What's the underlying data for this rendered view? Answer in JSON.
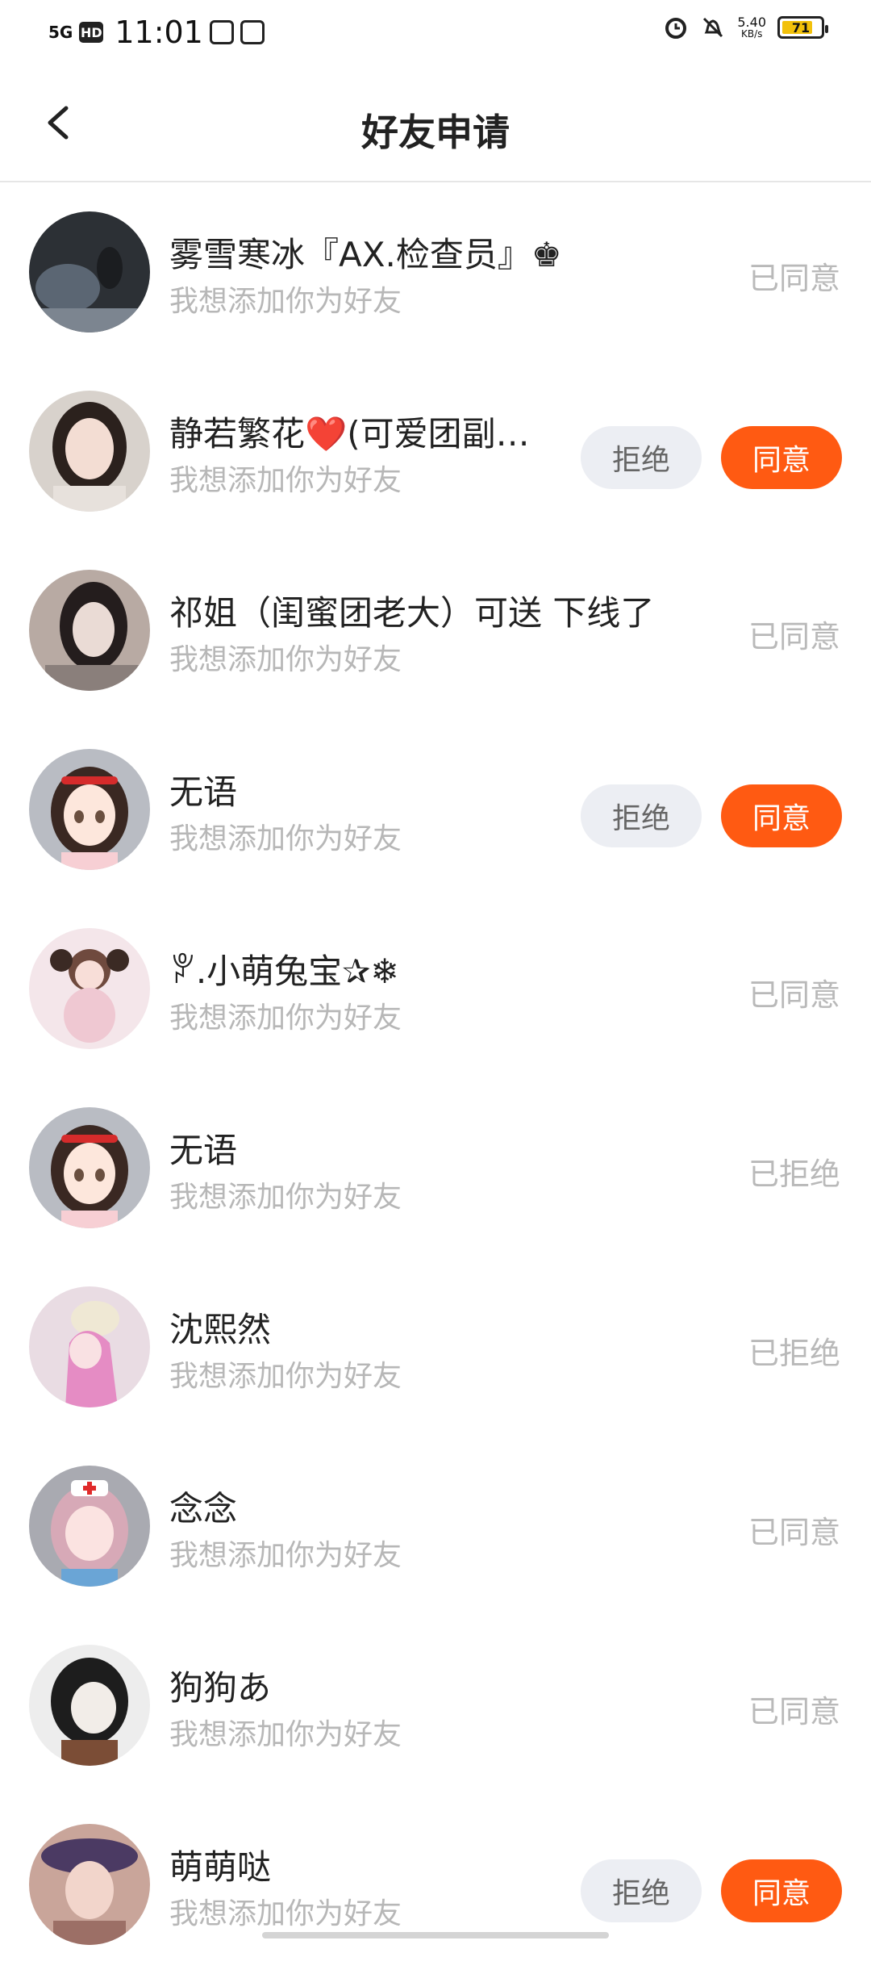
{
  "status_bar": {
    "network": "5G",
    "hd": "HD",
    "time": "11:01",
    "speed_value": "5.40",
    "speed_unit": "KB/s",
    "battery": "71"
  },
  "header": {
    "title": "好友申请"
  },
  "requests": [
    {
      "name": "雾雪寒冰『AX.检查员』♚",
      "message": "我想添加你为好友",
      "status": "已同意"
    },
    {
      "name": "静若繁花❤️(可爱团副…",
      "message": "我想添加你为好友",
      "reject_label": "拒绝",
      "accept_label": "同意"
    },
    {
      "name": "祁姐（闺蜜团老大）可送 下线了",
      "message": "我想添加你为好友",
      "status": "已同意"
    },
    {
      "name": "无语",
      "message": "我想添加你为好友",
      "reject_label": "拒绝",
      "accept_label": "同意"
    },
    {
      "name": "ꐕ.小萌兔宝✰❄",
      "message": "我想添加你为好友",
      "status": "已同意"
    },
    {
      "name": "无语",
      "message": "我想添加你为好友",
      "status": "已拒绝"
    },
    {
      "name": "沈熙然",
      "message": "我想添加你为好友",
      "status": "已拒绝"
    },
    {
      "name": "念念",
      "message": "我想添加你为好友",
      "status": "已同意"
    },
    {
      "name": "狗狗あ",
      "message": "我想添加你为好友",
      "status": "已同意"
    },
    {
      "name": "萌萌哒",
      "message": "我想添加你为好友",
      "reject_label": "拒绝",
      "accept_label": "同意"
    }
  ],
  "colors": {
    "accept": "#ff5a12",
    "reject_bg": "#eceef3",
    "status_text": "#b9b9b9",
    "battery": "#f2c10b"
  }
}
